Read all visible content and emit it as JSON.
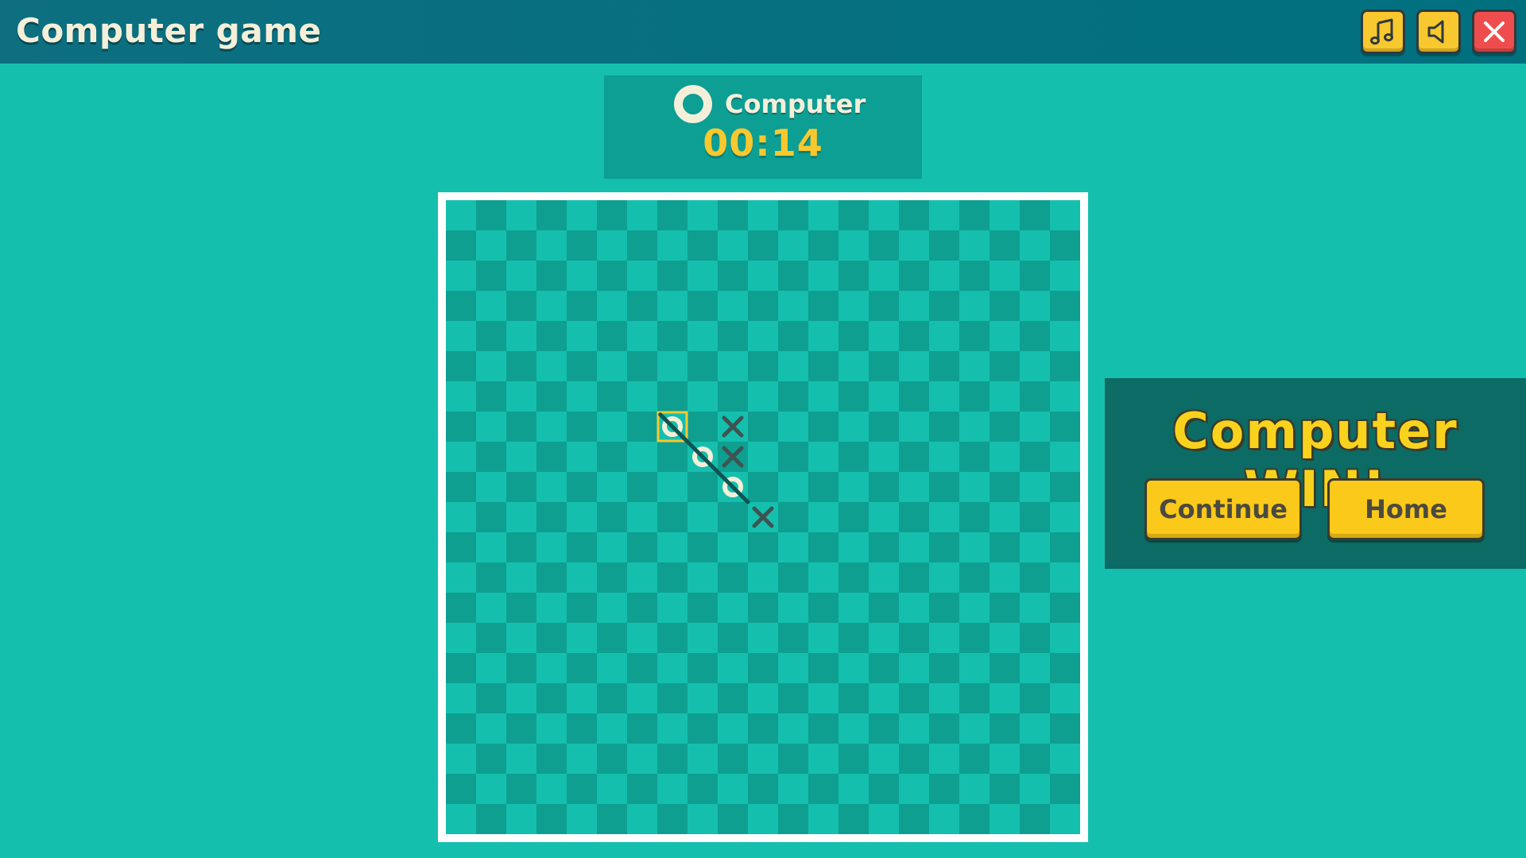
{
  "header": {
    "title": "Computer game",
    "buttons": [
      {
        "name": "music",
        "icon": "music-note-icon"
      },
      {
        "name": "sound",
        "icon": "speaker-icon"
      },
      {
        "name": "close",
        "icon": "close-icon"
      }
    ]
  },
  "player_panel": {
    "symbol": "O",
    "name": "Computer",
    "timer": "00:14"
  },
  "board": {
    "rows": 21,
    "cols": 21,
    "pieces": [
      {
        "row": 7,
        "col": 7,
        "mark": "O",
        "highlighted": true
      },
      {
        "row": 7,
        "col": 9,
        "mark": "X"
      },
      {
        "row": 8,
        "col": 8,
        "mark": "O"
      },
      {
        "row": 8,
        "col": 9,
        "mark": "X"
      },
      {
        "row": 9,
        "col": 9,
        "mark": "O"
      },
      {
        "row": 10,
        "col": 10,
        "mark": "X"
      }
    ],
    "win_line": {
      "from": {
        "row": 6.6,
        "col": 6.6
      },
      "to": {
        "row": 9.5,
        "col": 9.5
      }
    }
  },
  "result": {
    "message": "Computer WIN!",
    "continue_label": "Continue",
    "home_label": "Home"
  },
  "colors": {
    "background": "#15bfad",
    "header": "#00707f",
    "accent": "#f9c82e",
    "o_mark": "#f4efd9",
    "x_mark": "#3d5452",
    "win_line": "#0f5553"
  }
}
